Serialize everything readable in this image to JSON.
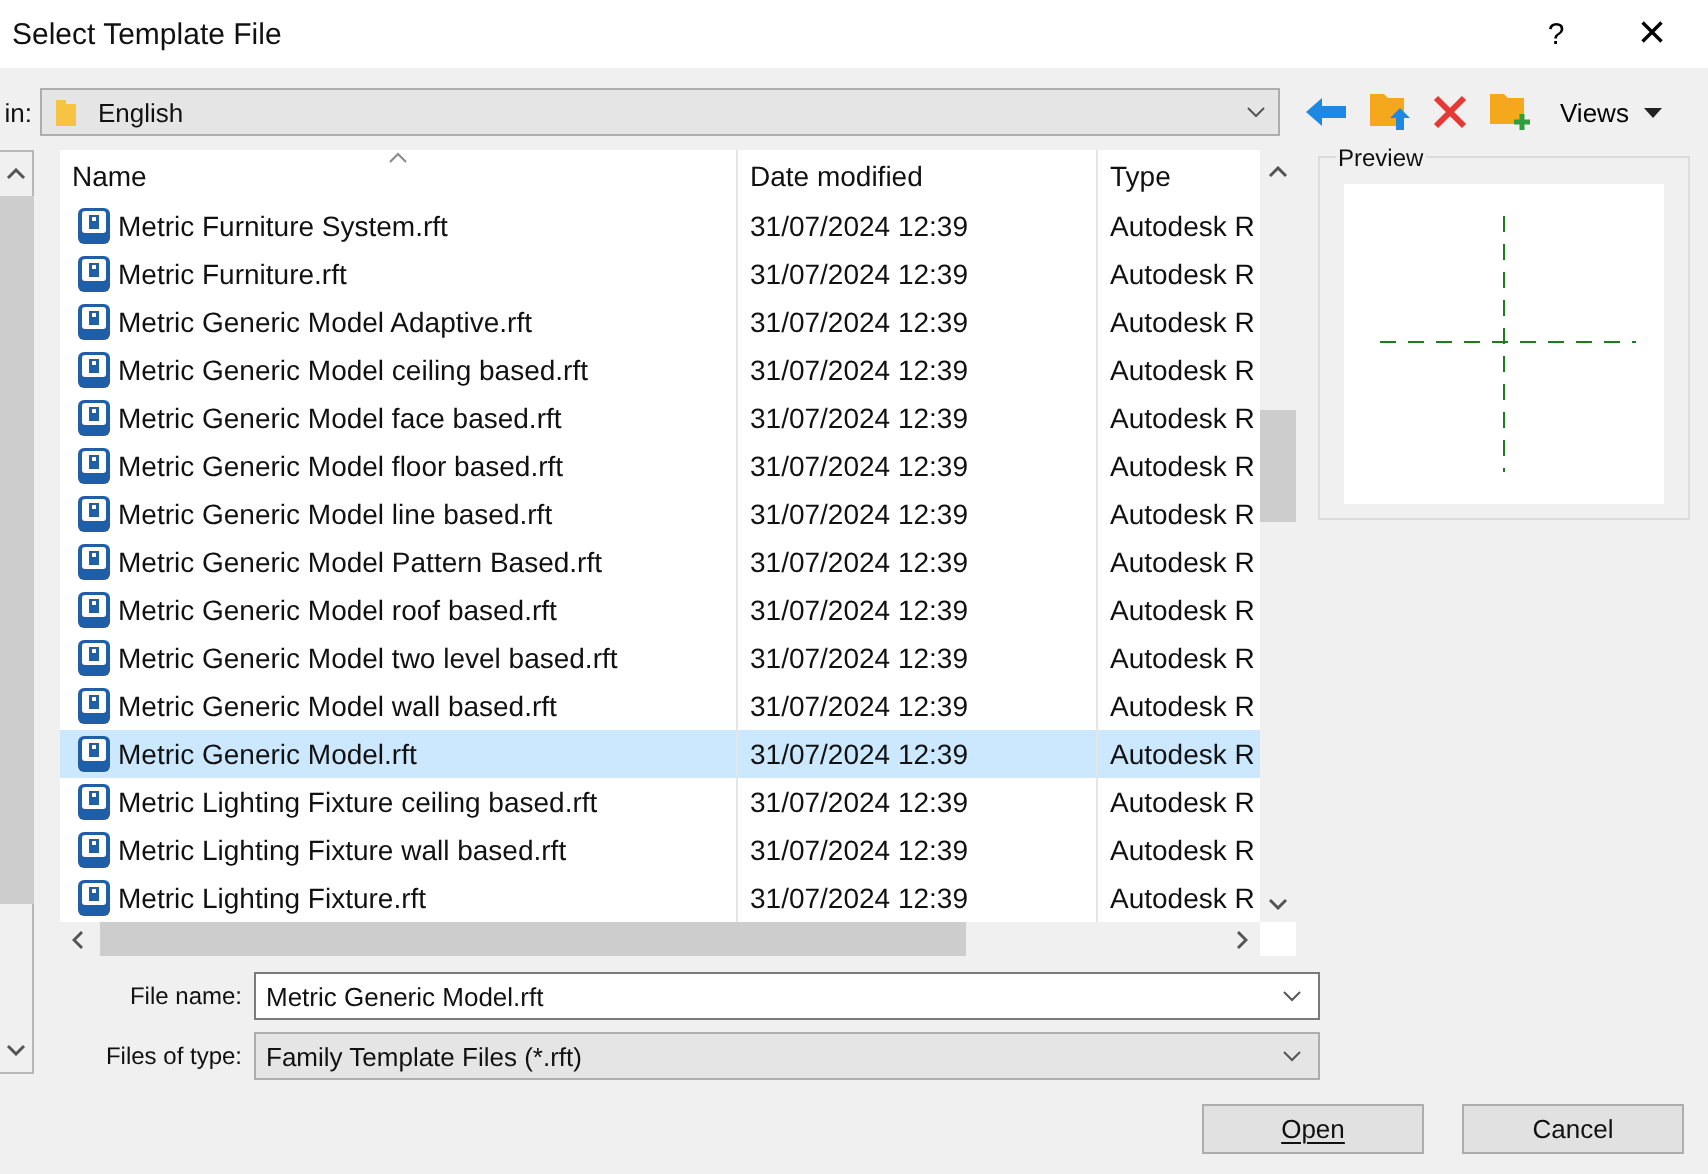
{
  "window": {
    "title": "Select Template File",
    "help": "?",
    "close": "×"
  },
  "look_in": {
    "label": "in:",
    "value": "English"
  },
  "toolbar": {
    "views": "Views"
  },
  "columns": [
    {
      "label": "Name",
      "sorted": true
    },
    {
      "label": "Date modified",
      "sorted": false
    },
    {
      "label": "Type",
      "sorted": false
    }
  ],
  "rows": [
    {
      "name": "Metric Furniture System.rft",
      "date": "31/07/2024 12:39",
      "type": "Autodesk R",
      "selected": false
    },
    {
      "name": "Metric Furniture.rft",
      "date": "31/07/2024 12:39",
      "type": "Autodesk R",
      "selected": false
    },
    {
      "name": "Metric Generic Model Adaptive.rft",
      "date": "31/07/2024 12:39",
      "type": "Autodesk R",
      "selected": false
    },
    {
      "name": "Metric Generic Model ceiling based.rft",
      "date": "31/07/2024 12:39",
      "type": "Autodesk R",
      "selected": false
    },
    {
      "name": "Metric Generic Model face based.rft",
      "date": "31/07/2024 12:39",
      "type": "Autodesk R",
      "selected": false
    },
    {
      "name": "Metric Generic Model floor based.rft",
      "date": "31/07/2024 12:39",
      "type": "Autodesk R",
      "selected": false
    },
    {
      "name": "Metric Generic Model line based.rft",
      "date": "31/07/2024 12:39",
      "type": "Autodesk R",
      "selected": false
    },
    {
      "name": "Metric Generic Model Pattern Based.rft",
      "date": "31/07/2024 12:39",
      "type": "Autodesk R",
      "selected": false
    },
    {
      "name": "Metric Generic Model roof based.rft",
      "date": "31/07/2024 12:39",
      "type": "Autodesk R",
      "selected": false
    },
    {
      "name": "Metric Generic Model two level based.rft",
      "date": "31/07/2024 12:39",
      "type": "Autodesk R",
      "selected": false
    },
    {
      "name": "Metric Generic Model wall based.rft",
      "date": "31/07/2024 12:39",
      "type": "Autodesk R",
      "selected": false
    },
    {
      "name": "Metric Generic Model.rft",
      "date": "31/07/2024 12:39",
      "type": "Autodesk R",
      "selected": true
    },
    {
      "name": "Metric Lighting Fixture ceiling based.rft",
      "date": "31/07/2024 12:39",
      "type": "Autodesk R",
      "selected": false
    },
    {
      "name": "Metric Lighting Fixture wall based.rft",
      "date": "31/07/2024 12:39",
      "type": "Autodesk R",
      "selected": false
    },
    {
      "name": "Metric Lighting Fixture.rft",
      "date": "31/07/2024 12:39",
      "type": "Autodesk R",
      "selected": false
    }
  ],
  "preview": {
    "label": "Preview"
  },
  "file_name": {
    "label": "File name:",
    "value": "Metric Generic Model.rft"
  },
  "file_type": {
    "label": "Files of type:",
    "value": "Family Template Files (*.rft)"
  },
  "buttons": [
    {
      "label": "Open",
      "kind": "default"
    },
    {
      "label": "Cancel",
      "kind": "normal"
    }
  ]
}
